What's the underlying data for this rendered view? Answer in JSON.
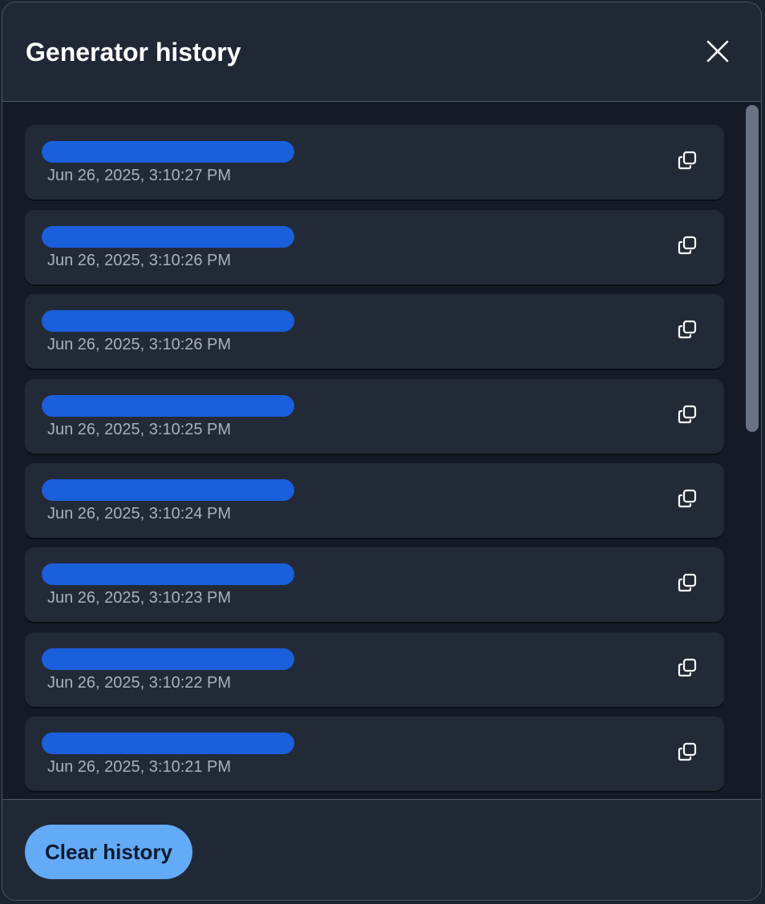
{
  "dialog": {
    "title": "Generator history"
  },
  "items": [
    {
      "timestamp": "Jun 26, 2025, 3:10:27 PM"
    },
    {
      "timestamp": "Jun 26, 2025, 3:10:26 PM"
    },
    {
      "timestamp": "Jun 26, 2025, 3:10:26 PM"
    },
    {
      "timestamp": "Jun 26, 2025, 3:10:25 PM"
    },
    {
      "timestamp": "Jun 26, 2025, 3:10:24 PM"
    },
    {
      "timestamp": "Jun 26, 2025, 3:10:23 PM"
    },
    {
      "timestamp": "Jun 26, 2025, 3:10:22 PM"
    },
    {
      "timestamp": "Jun 26, 2025, 3:10:21 PM"
    }
  ],
  "footer": {
    "clear_label": "Clear history"
  },
  "icons": {
    "close": "close-icon",
    "copy": "copy-icon"
  },
  "colors": {
    "accent": "#63aaf7",
    "redaction": "#1a5fdc",
    "background": "#202836"
  }
}
